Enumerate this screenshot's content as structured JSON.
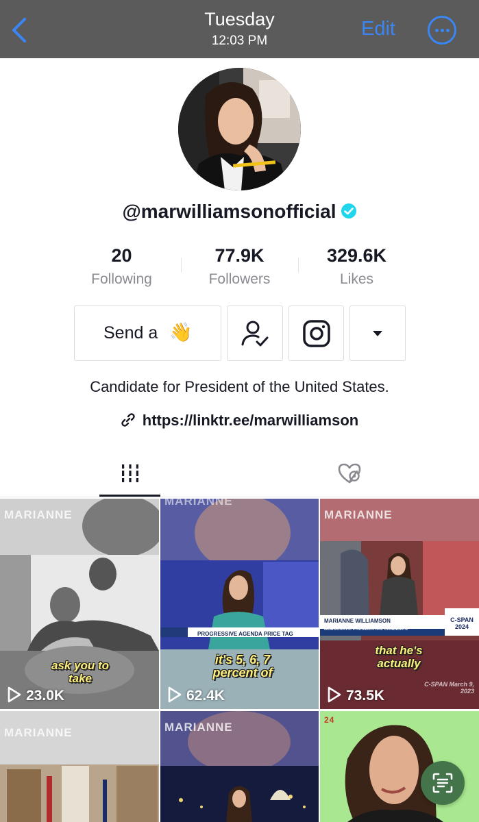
{
  "status_bar": {
    "day": "Tuesday",
    "time": "12:03 PM",
    "edit_label": "Edit"
  },
  "profile": {
    "username": "@marwilliamsonofficial",
    "stats": [
      {
        "value": "20",
        "label": "Following"
      },
      {
        "value": "77.9K",
        "label": "Followers"
      },
      {
        "value": "329.6K",
        "label": "Likes"
      }
    ],
    "send_button_label": "Send a",
    "send_button_emoji": "👋",
    "bio": "Candidate for President of the United States.",
    "link": "https://linktr.ee/marwilliamson"
  },
  "icons": {
    "back": "chevron-left-icon",
    "more": "more-icon",
    "verified": "verified-badge-icon",
    "friend": "user-check-icon",
    "instagram": "instagram-icon",
    "dropdown": "caret-down-icon",
    "link": "link-icon",
    "videos_tab": "grid-icon",
    "liked_tab": "hidden-heart-icon",
    "play": "play-icon",
    "scan": "text-scan-icon"
  },
  "videos": [
    {
      "watermark": "MARIANNE",
      "caption": "ask you to take",
      "views": "23.0K"
    },
    {
      "watermark": "MARIANNE",
      "caption": "it's 5, 6, 7 percent of",
      "views": "62.4K",
      "lower_third": "PROGRESSIVE AGENDA PRICE TAG"
    },
    {
      "watermark": "MARIANNE",
      "caption": "that he's actually",
      "views": "73.5K",
      "lower_third": "MARIANNE WILLIAMSON",
      "lower_third_sub": "DEMOCRATIC PRESIDENTIAL CANDIDATE",
      "network": "C-SPAN 2024",
      "credit": "C-SPAN March 9, 2023"
    },
    {
      "watermark": "MARIANNE"
    },
    {
      "watermark": "MARIANNE"
    },
    {
      "watermark": "24"
    }
  ],
  "colors": {
    "accent_blue": "#3a86f5",
    "verified": "#20d5ec",
    "caption_yellow": "#fff07a",
    "scan_green": "#44744a"
  }
}
